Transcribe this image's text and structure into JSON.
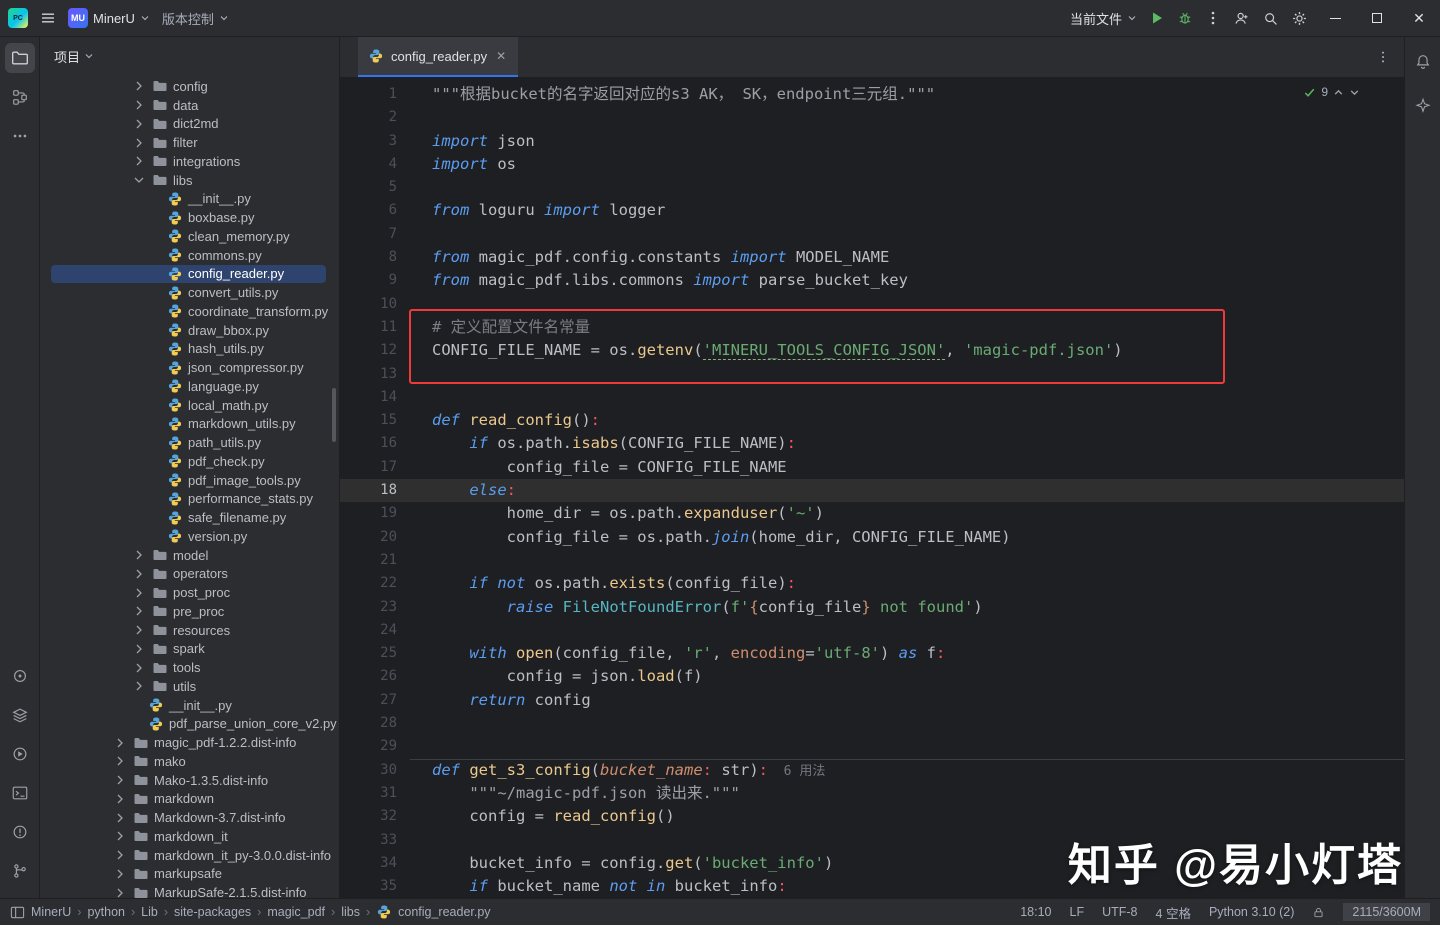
{
  "titlebar": {
    "logo_text": "PC",
    "chip_text": "MU",
    "project_name": "MinerU",
    "vcs_label": "版本控制",
    "current_file_label": "当前文件"
  },
  "project_panel": {
    "header": "项目",
    "tree": [
      {
        "label": "config",
        "type": "folder",
        "level": 1
      },
      {
        "label": "data",
        "type": "folder",
        "level": 1
      },
      {
        "label": "dict2md",
        "type": "folder",
        "level": 1
      },
      {
        "label": "filter",
        "type": "folder",
        "level": 1
      },
      {
        "label": "integrations",
        "type": "folder",
        "level": 1
      },
      {
        "label": "libs",
        "type": "folder",
        "level": 1,
        "open": true
      },
      {
        "label": "__init__.py",
        "type": "py",
        "level": 2
      },
      {
        "label": "boxbase.py",
        "type": "py",
        "level": 2
      },
      {
        "label": "clean_memory.py",
        "type": "py",
        "level": 2
      },
      {
        "label": "commons.py",
        "type": "py",
        "level": 2
      },
      {
        "label": "config_reader.py",
        "type": "py",
        "level": 2,
        "selected": true
      },
      {
        "label": "convert_utils.py",
        "type": "py",
        "level": 2
      },
      {
        "label": "coordinate_transform.py",
        "type": "py",
        "level": 2
      },
      {
        "label": "draw_bbox.py",
        "type": "py",
        "level": 2
      },
      {
        "label": "hash_utils.py",
        "type": "py",
        "level": 2
      },
      {
        "label": "json_compressor.py",
        "type": "py",
        "level": 2
      },
      {
        "label": "language.py",
        "type": "py",
        "level": 2
      },
      {
        "label": "local_math.py",
        "type": "py",
        "level": 2
      },
      {
        "label": "markdown_utils.py",
        "type": "py",
        "level": 2
      },
      {
        "label": "path_utils.py",
        "type": "py",
        "level": 2
      },
      {
        "label": "pdf_check.py",
        "type": "py",
        "level": 2
      },
      {
        "label": "pdf_image_tools.py",
        "type": "py",
        "level": 2
      },
      {
        "label": "performance_stats.py",
        "type": "py",
        "level": 2
      },
      {
        "label": "safe_filename.py",
        "type": "py",
        "level": 2
      },
      {
        "label": "version.py",
        "type": "py",
        "level": 2
      },
      {
        "label": "model",
        "type": "folder",
        "level": 1
      },
      {
        "label": "operators",
        "type": "folder",
        "level": 1
      },
      {
        "label": "post_proc",
        "type": "folder",
        "level": 1
      },
      {
        "label": "pre_proc",
        "type": "folder",
        "level": 1
      },
      {
        "label": "resources",
        "type": "folder",
        "level": 1
      },
      {
        "label": "spark",
        "type": "folder",
        "level": 1
      },
      {
        "label": "tools",
        "type": "folder",
        "level": 1
      },
      {
        "label": "utils",
        "type": "folder",
        "level": 1
      },
      {
        "label": "__init__.py",
        "type": "py",
        "level": 1
      },
      {
        "label": "pdf_parse_union_core_v2.py",
        "type": "py",
        "level": 1
      },
      {
        "label": "magic_pdf-1.2.2.dist-info",
        "type": "folder",
        "level": 0
      },
      {
        "label": "mako",
        "type": "folder",
        "level": 0
      },
      {
        "label": "Mako-1.3.5.dist-info",
        "type": "folder",
        "level": 0
      },
      {
        "label": "markdown",
        "type": "folder",
        "level": 0
      },
      {
        "label": "Markdown-3.7.dist-info",
        "type": "folder",
        "level": 0
      },
      {
        "label": "markdown_it",
        "type": "folder",
        "level": 0
      },
      {
        "label": "markdown_it_py-3.0.0.dist-info",
        "type": "folder",
        "level": 0
      },
      {
        "label": "markupsafe",
        "type": "folder",
        "level": 0
      },
      {
        "label": "MarkupSafe-2.1.5.dist-info",
        "type": "folder",
        "level": 0
      }
    ]
  },
  "editor": {
    "tab": "config_reader.py",
    "inspection_count": "9",
    "annotations": {
      "current_line": 18,
      "box": {
        "from_line": 11,
        "to_line": 13
      }
    },
    "lines": [
      {
        "n": 1,
        "t": [
          [
            "doc",
            "\"\"\"根据bucket的名字返回对应的s3 AK， SK，endpoint三元组.\"\"\""
          ]
        ]
      },
      {
        "n": 2,
        "t": []
      },
      {
        "n": 3,
        "t": [
          [
            "k",
            "import"
          ],
          [
            "d",
            " json"
          ]
        ]
      },
      {
        "n": 4,
        "t": [
          [
            "k",
            "import"
          ],
          [
            "d",
            " os"
          ]
        ]
      },
      {
        "n": 5,
        "t": []
      },
      {
        "n": 6,
        "t": [
          [
            "k",
            "from"
          ],
          [
            "d",
            " loguru "
          ],
          [
            "k",
            "import"
          ],
          [
            "d",
            " logger"
          ]
        ]
      },
      {
        "n": 7,
        "t": []
      },
      {
        "n": 8,
        "t": [
          [
            "k",
            "from"
          ],
          [
            "d",
            " magic_pdf.config.constants "
          ],
          [
            "k",
            "import"
          ],
          [
            "d",
            " MODEL_NAME"
          ]
        ]
      },
      {
        "n": 9,
        "t": [
          [
            "k",
            "from"
          ],
          [
            "d",
            " magic_pdf.libs.commons "
          ],
          [
            "k",
            "import"
          ],
          [
            "d",
            " parse_bucket_key"
          ]
        ]
      },
      {
        "n": 10,
        "t": []
      },
      {
        "n": 11,
        "t": [
          [
            "c",
            "# 定义配置文件名常量"
          ]
        ]
      },
      {
        "n": 12,
        "t": [
          [
            "d",
            "CONFIG_FILE_NAME = os."
          ],
          [
            "fn",
            "getenv"
          ],
          [
            "d",
            "("
          ],
          [
            "su",
            "'MINERU_TOOLS_CONFIG_JSON'"
          ],
          [
            "d",
            ", "
          ],
          [
            "s",
            "'magic-pdf.json'"
          ],
          [
            "d",
            ")"
          ]
        ]
      },
      {
        "n": 13,
        "t": []
      },
      {
        "n": 14,
        "t": []
      },
      {
        "n": 15,
        "t": [
          [
            "k",
            "def "
          ],
          [
            "fn",
            "read_config"
          ],
          [
            "d",
            "()"
          ],
          [
            "col",
            ":"
          ]
        ]
      },
      {
        "n": 16,
        "t": [
          [
            "d",
            "    "
          ],
          [
            "k",
            "if"
          ],
          [
            "d",
            " os.path."
          ],
          [
            "fn",
            "isabs"
          ],
          [
            "d",
            "(CONFIG_FILE_NAME)"
          ],
          [
            "col",
            ":"
          ]
        ]
      },
      {
        "n": 17,
        "t": [
          [
            "d",
            "        config_file = CONFIG_FILE_NAME"
          ]
        ]
      },
      {
        "n": 18,
        "t": [
          [
            "d",
            "    "
          ],
          [
            "k",
            "else"
          ],
          [
            "col",
            ":"
          ]
        ]
      },
      {
        "n": 19,
        "t": [
          [
            "d",
            "        home_dir = os.path."
          ],
          [
            "fn",
            "expanduser"
          ],
          [
            "d",
            "("
          ],
          [
            "s",
            "'~'"
          ],
          [
            "d",
            ")"
          ]
        ]
      },
      {
        "n": 20,
        "t": [
          [
            "d",
            "        config_file = os.path."
          ],
          [
            "kc",
            "join"
          ],
          [
            "d",
            "(home_dir, CONFIG_FILE_NAME)"
          ]
        ]
      },
      {
        "n": 21,
        "t": []
      },
      {
        "n": 22,
        "t": [
          [
            "d",
            "    "
          ],
          [
            "k",
            "if"
          ],
          [
            "d",
            " "
          ],
          [
            "k",
            "not"
          ],
          [
            "d",
            " os.path."
          ],
          [
            "fn",
            "exists"
          ],
          [
            "d",
            "(config_file)"
          ],
          [
            "col",
            ":"
          ]
        ]
      },
      {
        "n": 23,
        "t": [
          [
            "d",
            "        "
          ],
          [
            "k",
            "raise"
          ],
          [
            "d",
            " "
          ],
          [
            "cls",
            "FileNotFoundError"
          ],
          [
            "d",
            "("
          ],
          [
            "s",
            "f'"
          ],
          [
            "br",
            "{"
          ],
          [
            "d",
            "config_file"
          ],
          [
            "br",
            "}"
          ],
          [
            "s",
            " not found'"
          ],
          [
            "d",
            ")"
          ]
        ]
      },
      {
        "n": 24,
        "t": []
      },
      {
        "n": 25,
        "t": [
          [
            "d",
            "    "
          ],
          [
            "k",
            "with"
          ],
          [
            "d",
            " "
          ],
          [
            "fn",
            "open"
          ],
          [
            "d",
            "(config_file, "
          ],
          [
            "s",
            "'r'"
          ],
          [
            "d",
            ", "
          ],
          [
            "prm",
            "encoding"
          ],
          [
            "d",
            "="
          ],
          [
            "s",
            "'utf-8'"
          ],
          [
            "d",
            ") "
          ],
          [
            "k",
            "as"
          ],
          [
            "d",
            " f"
          ],
          [
            "col",
            ":"
          ]
        ]
      },
      {
        "n": 26,
        "t": [
          [
            "d",
            "        config = json."
          ],
          [
            "fn",
            "load"
          ],
          [
            "d",
            "(f)"
          ]
        ]
      },
      {
        "n": 27,
        "t": [
          [
            "d",
            "    "
          ],
          [
            "k",
            "return"
          ],
          [
            "d",
            " config"
          ]
        ]
      },
      {
        "n": 28,
        "t": []
      },
      {
        "n": 29,
        "t": []
      },
      {
        "n": 30,
        "sep": true,
        "t": [
          [
            "k",
            "def "
          ],
          [
            "fn",
            "get_s3_config"
          ],
          [
            "d",
            "("
          ],
          [
            "pi",
            "bucket_name"
          ],
          [
            "col",
            ":"
          ],
          [
            "d",
            " str)"
          ],
          [
            "col",
            ":"
          ],
          [
            "inlay",
            "  6 用法"
          ]
        ]
      },
      {
        "n": 31,
        "t": [
          [
            "d",
            "    "
          ],
          [
            "doc",
            "\"\"\"~/magic-pdf.json 读出来.\"\"\""
          ]
        ]
      },
      {
        "n": 32,
        "t": [
          [
            "d",
            "    config = "
          ],
          [
            "fn",
            "read_config"
          ],
          [
            "d",
            "()"
          ]
        ]
      },
      {
        "n": 33,
        "t": []
      },
      {
        "n": 34,
        "t": [
          [
            "d",
            "    bucket_info = config."
          ],
          [
            "fn",
            "get"
          ],
          [
            "d",
            "("
          ],
          [
            "s",
            "'bucket_info'"
          ],
          [
            "d",
            ")"
          ]
        ]
      },
      {
        "n": 35,
        "t": [
          [
            "d",
            "    "
          ],
          [
            "k",
            "if"
          ],
          [
            "d",
            " bucket_name "
          ],
          [
            "k",
            "not"
          ],
          [
            "d",
            " "
          ],
          [
            "k",
            "in"
          ],
          [
            "d",
            " bucket_info"
          ],
          [
            "col",
            ":"
          ]
        ]
      }
    ]
  },
  "status_bar": {
    "breadcrumbs": [
      "MinerU",
      "python",
      "Lib",
      "site-packages",
      "magic_pdf",
      "libs",
      "config_reader.py"
    ],
    "right_items": [
      "18:10",
      "LF",
      "UTF-8",
      "4 空格",
      "Python 3.10 (2)"
    ],
    "memory": "2115/3600M"
  },
  "watermark": "知乎 @易小灯塔"
}
